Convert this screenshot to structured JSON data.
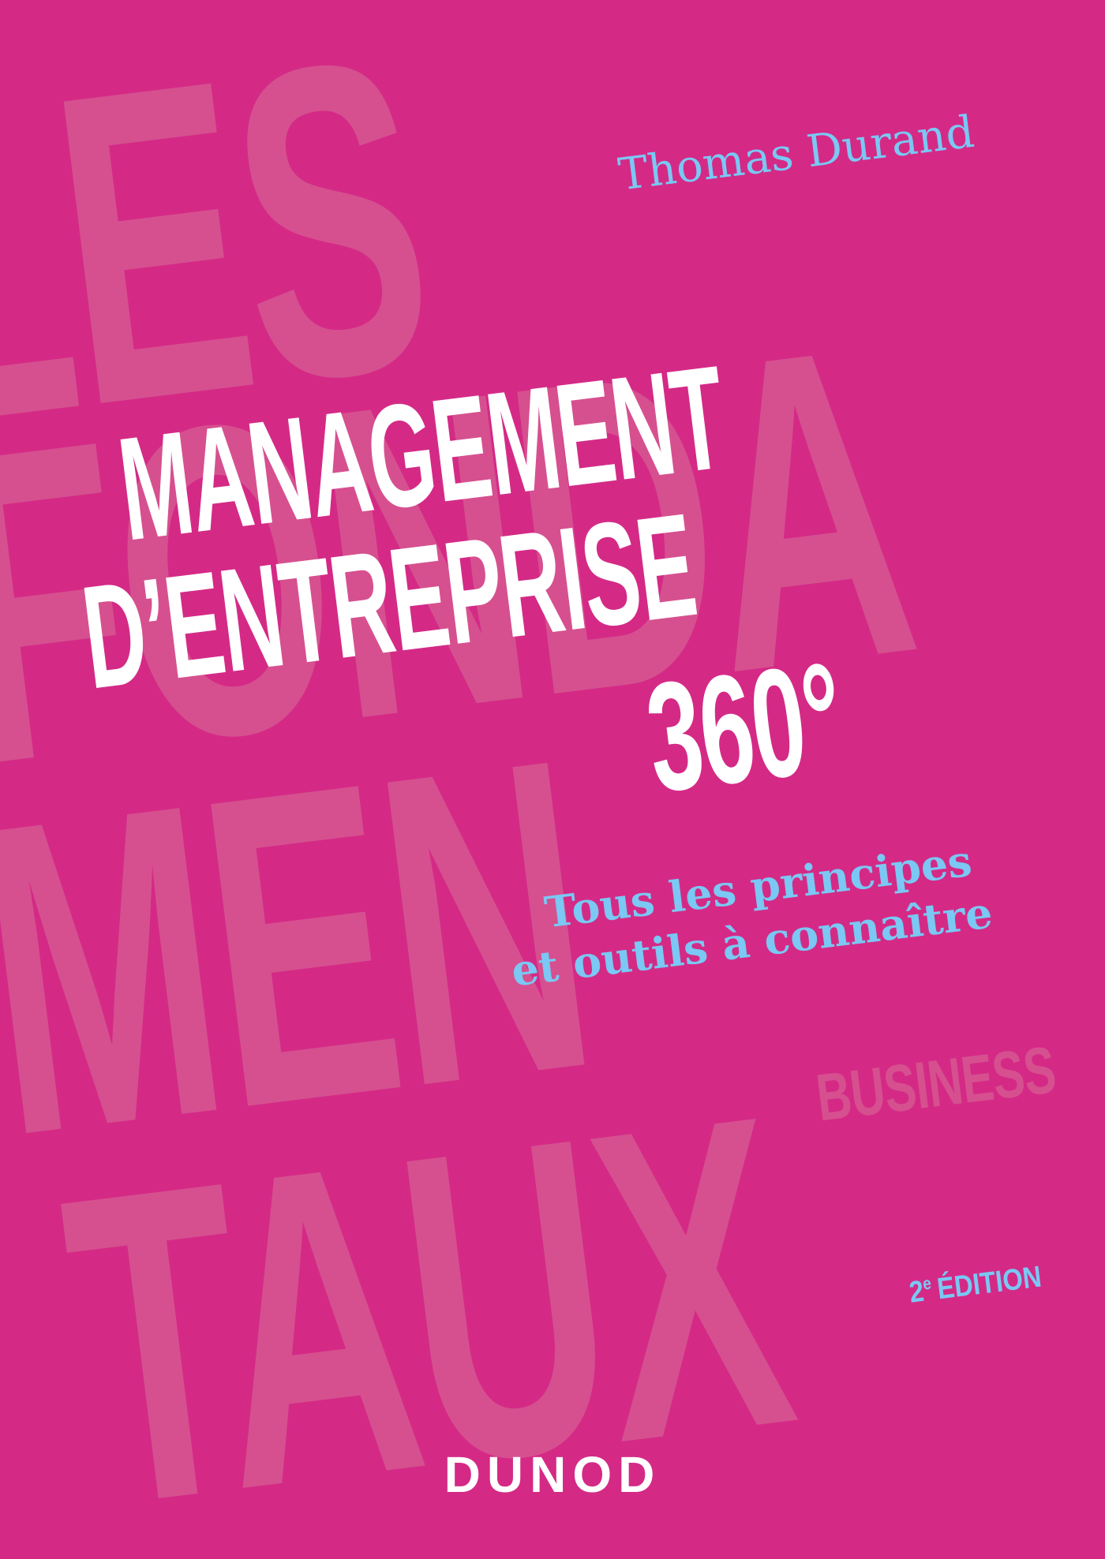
{
  "cover": {
    "background_words": [
      "LES",
      "FONDA",
      "MEN",
      "TAUX"
    ],
    "series_label": "BUSINESS",
    "author": "Thomas Durand",
    "title_lines": [
      "MANAGEMENT",
      "D’ENTREPRISE",
      "360°"
    ],
    "subtitle_lines": [
      "Tous les principes",
      "et outils à connaître"
    ],
    "edition": {
      "number": "2",
      "suffix": "e",
      "label": "ÉDITION"
    },
    "publisher": "DUNOD"
  },
  "colors": {
    "background": "#d42a86",
    "background_text": "#d6508f",
    "title": "#ffffff",
    "accent": "#7ac8f3"
  }
}
